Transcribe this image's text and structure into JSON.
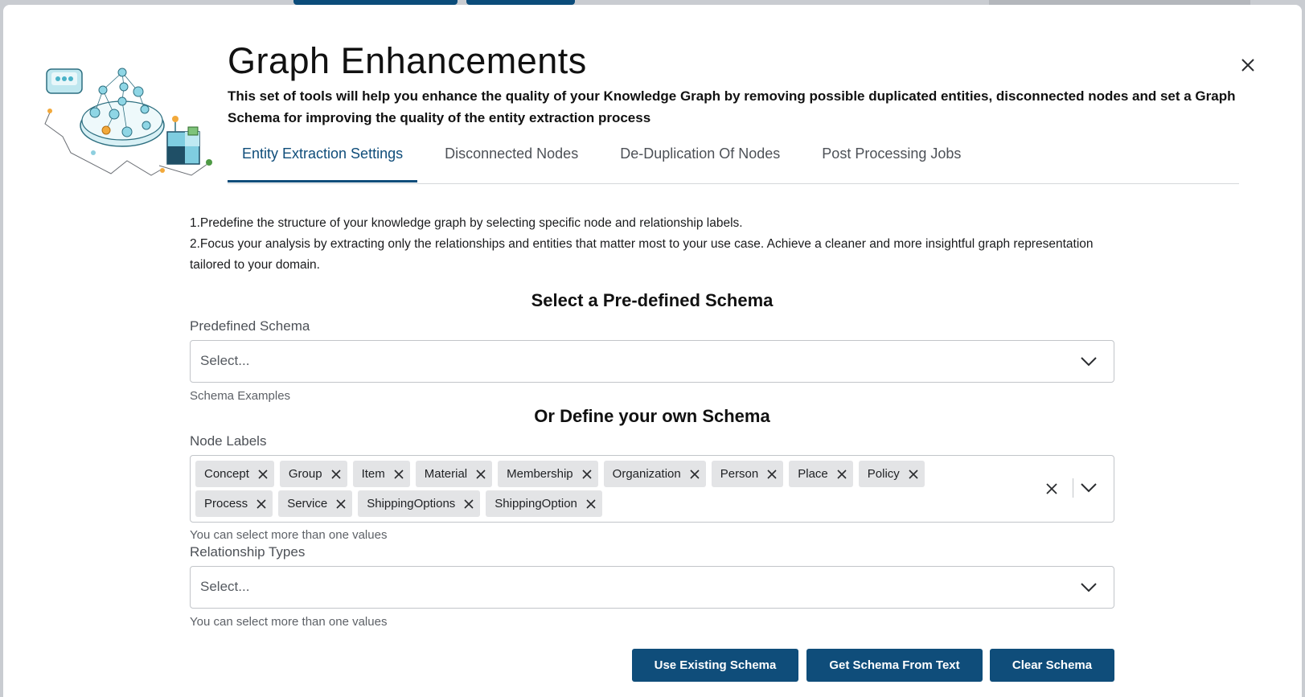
{
  "modal": {
    "title": "Graph Enhancements",
    "description": "This set of tools will help you enhance the quality of your Knowledge Graph by removing possible duplicated entities, disconnected nodes and set a Graph Schema for improving the quality of the entity extraction process"
  },
  "tabs": [
    {
      "label": "Entity Extraction Settings",
      "active": true
    },
    {
      "label": "Disconnected Nodes",
      "active": false
    },
    {
      "label": "De-Duplication Of Nodes",
      "active": false
    },
    {
      "label": "Post Processing Jobs",
      "active": false
    }
  ],
  "instructions": {
    "line1": "1.Predefine the structure of your knowledge graph by selecting specific node and relationship labels.",
    "line2": "2.Focus your analysis by extracting only the relationships and entities that matter most to your use case. Achieve a cleaner and more insightful graph representation tailored to your domain."
  },
  "predefined": {
    "heading": "Select a Pre-defined Schema",
    "label": "Predefined Schema",
    "placeholder": "Select...",
    "helper": "Schema Examples"
  },
  "custom": {
    "heading": "Or Define your own Schema",
    "node_labels": {
      "label": "Node Labels",
      "chips": [
        "Concept",
        "Group",
        "Item",
        "Material",
        "Membership",
        "Organization",
        "Person",
        "Place",
        "Policy",
        "Process",
        "Service",
        "ShippingOptions",
        "ShippingOption"
      ],
      "helper": "You can select more than one values"
    },
    "relationship_types": {
      "label": "Relationship Types",
      "placeholder": "Select...",
      "helper": "You can select more than one values"
    }
  },
  "buttons": {
    "use_existing": "Use Existing Schema",
    "from_text": "Get Schema From Text",
    "clear": "Clear Schema"
  },
  "icons": {
    "close": "close-icon",
    "chevron": "chevron-down-icon",
    "chip_remove": "close-icon",
    "illustration": "graph-illustration"
  },
  "colors": {
    "accent": "#0f4d7a",
    "chip_bg": "#e3e4e6"
  }
}
